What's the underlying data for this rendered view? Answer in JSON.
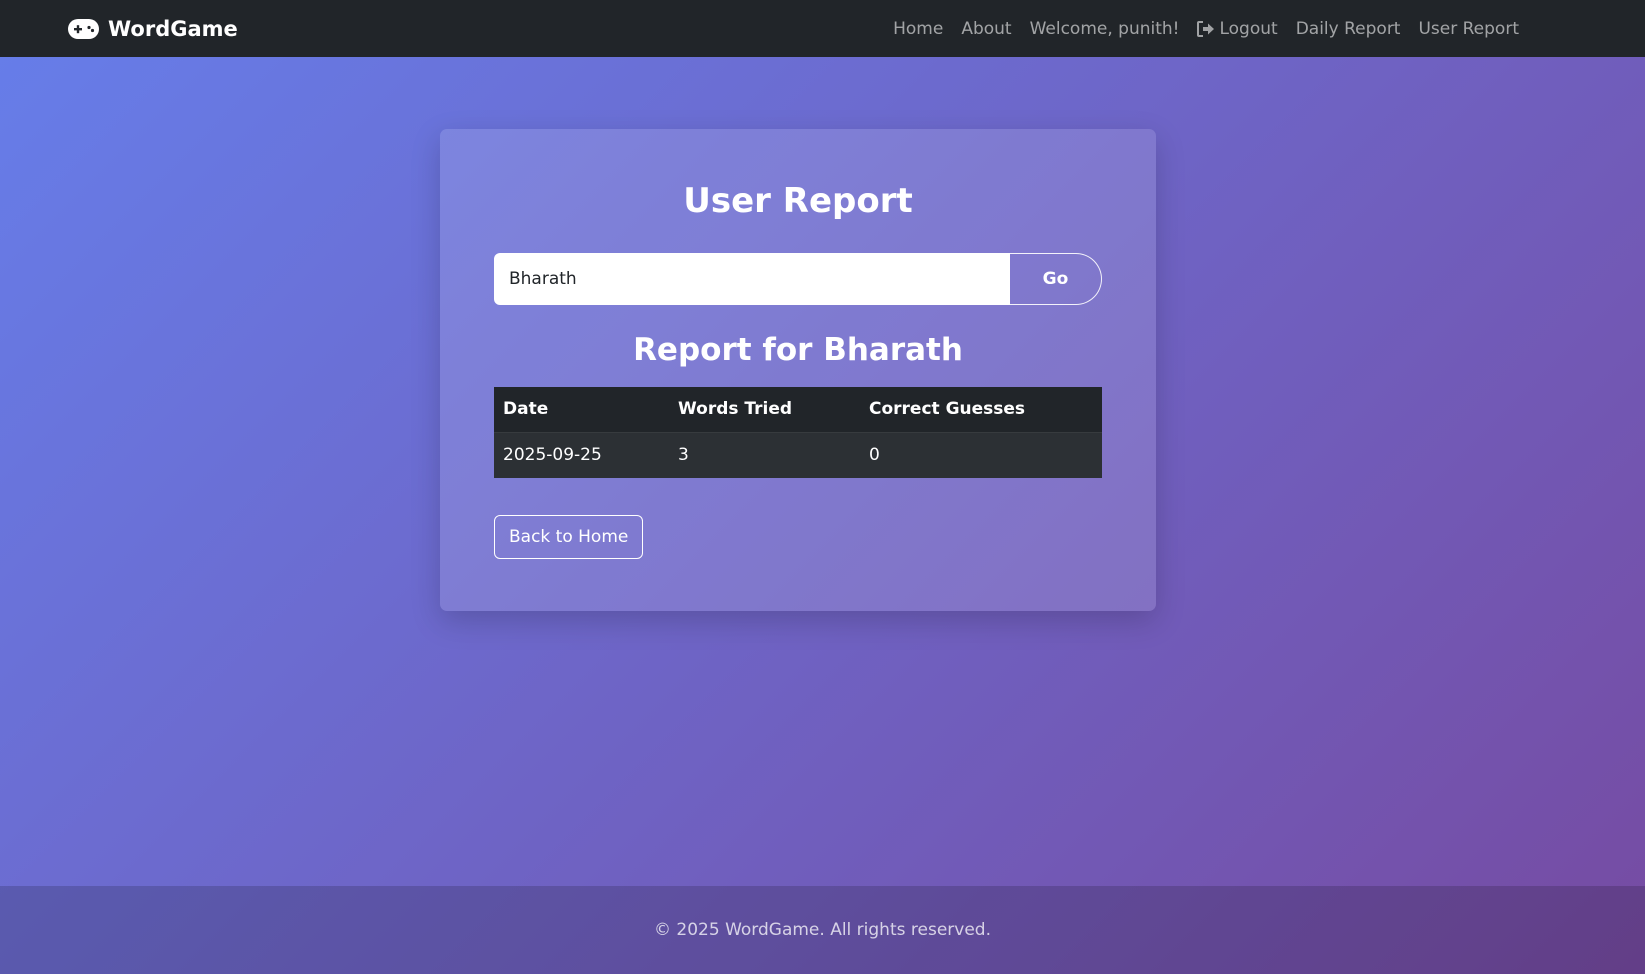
{
  "navbar": {
    "brand": "WordGame",
    "brand_icon": "gamepad-icon",
    "links": [
      {
        "label": "Home"
      },
      {
        "label": "About"
      },
      {
        "label": "Welcome, punith!"
      },
      {
        "label": "Logout",
        "icon": "logout-icon"
      },
      {
        "label": "Daily Report"
      },
      {
        "label": "User Report"
      }
    ]
  },
  "card": {
    "title": "User Report",
    "search": {
      "value": "Bharath",
      "button_label": "Go"
    },
    "report_heading": "Report for Bharath",
    "table": {
      "headers": [
        "Date",
        "Words Tried",
        "Correct Guesses"
      ],
      "rows": [
        [
          "2025-09-25",
          "3",
          "0"
        ]
      ]
    },
    "back_button_label": "Back to Home"
  },
  "footer": {
    "text": "© 2025 WordGame. All rights reserved."
  },
  "colors": {
    "navbar_bg": "#212529",
    "gradient_start": "#667eea",
    "gradient_end": "#764ba2",
    "table_header_bg": "#212529",
    "table_row_bg": "#2c3034"
  }
}
